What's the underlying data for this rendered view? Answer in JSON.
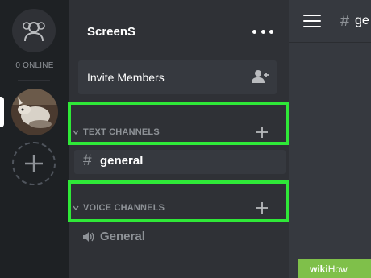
{
  "rail": {
    "online_count": "0 ONLINE"
  },
  "server": {
    "name": "ScreenS",
    "invite_label": "Invite Members"
  },
  "categories": {
    "text": {
      "label": "TEXT CHANNELS"
    },
    "voice": {
      "label": "VOICE CHANNELS"
    }
  },
  "channels": {
    "text": [
      {
        "prefix": "#",
        "name": "general",
        "selected": true
      }
    ],
    "voice": [
      {
        "name": "General"
      }
    ]
  },
  "main": {
    "channel_prefix": "#",
    "channel_name": "ge"
  },
  "watermark": {
    "part1": "wiki",
    "part2": "How"
  },
  "colors": {
    "highlight": "#2fe838",
    "rail_bg": "#1e2124",
    "sidebar_bg": "#2f3136",
    "main_bg": "#36393f"
  },
  "icons": {
    "friends": "friends-icon",
    "more": "more-icon",
    "invite": "add-user-icon",
    "add_channel": "plus-icon",
    "collapse": "chevron-down-icon",
    "voice": "speaker-icon",
    "menu": "hamburger-icon"
  }
}
